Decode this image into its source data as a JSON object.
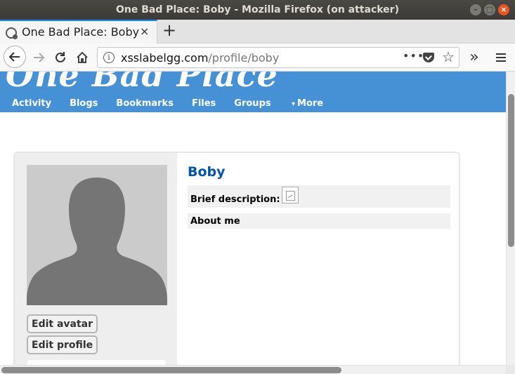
{
  "window": {
    "title": "One Bad Place: Boby - Mozilla Firefox (on attacker)"
  },
  "browser": {
    "tab_title": "One Bad Place: Boby",
    "tab_close": "×",
    "new_tab": "+",
    "url_host": "xsslabelgg.com",
    "url_path": "/profile/boby",
    "page_actions": "•••",
    "icons": [
      "back-arrow-icon",
      "forward-arrow-icon",
      "reload-icon",
      "home-icon",
      "info-icon",
      "pocket-icon",
      "bookmark-star-icon",
      "overflow-icon",
      "hamburger-menu-icon"
    ]
  },
  "site": {
    "logo": "One Bad Place",
    "header_color": "#4690d6",
    "nav": [
      {
        "label": "Activity"
      },
      {
        "label": "Blogs"
      },
      {
        "label": "Bookmarks"
      },
      {
        "label": "Files"
      },
      {
        "label": "Groups"
      }
    ],
    "more_label": "More",
    "more_caret": "▾"
  },
  "profile": {
    "name": "Boby",
    "name_color": "#0054a7",
    "brief_label": "Brief description:",
    "about_label": "About me",
    "edit_avatar": "Edit avatar",
    "edit_profile": "Edit profile"
  }
}
